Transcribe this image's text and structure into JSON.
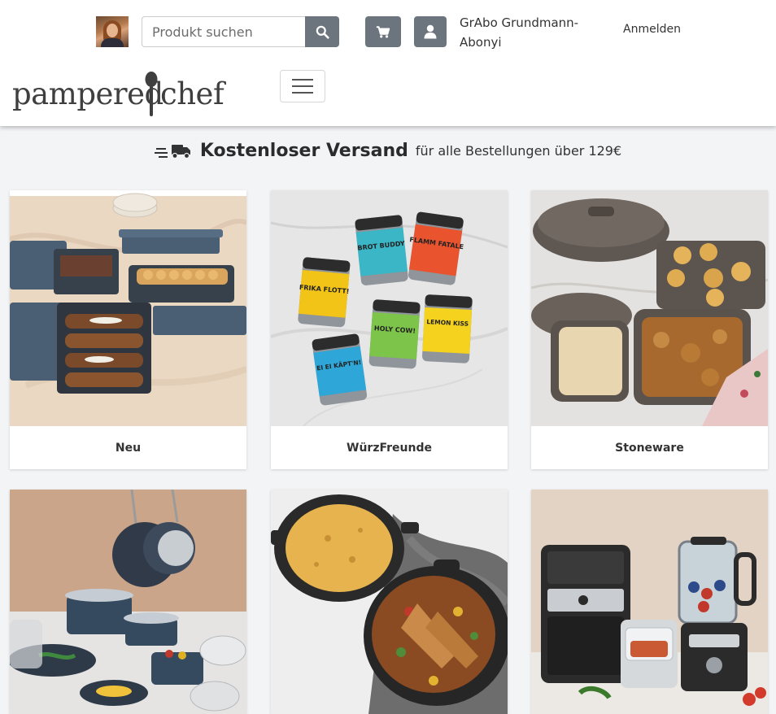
{
  "header": {
    "search": {
      "placeholder": "Produkt suchen",
      "icon": "search-icon"
    },
    "cart": {
      "icon": "cart-icon"
    },
    "user": {
      "icon": "user-icon",
      "name": "GrAbo Grundmann-Abonyi"
    },
    "login_label": "Anmelden",
    "logo": {
      "left": "pampered",
      "right": "chef"
    },
    "menu_icon": "hamburger-icon"
  },
  "shipping_banner": {
    "icon": "truck-icon",
    "bold": "Kostenloser Versand",
    "rest": "für alle Bestellungen über 129€"
  },
  "categories": [
    {
      "label": "Neu"
    },
    {
      "label": "WürzFreunde"
    },
    {
      "label": "Stoneware"
    },
    {
      "label": ""
    },
    {
      "label": ""
    },
    {
      "label": ""
    }
  ],
  "spice_labels": [
    "FRIKA FLOTT!",
    "BROT BUDDY",
    "FLAMM FATALE",
    "HOLY COW!",
    "LEMON KISS",
    "EI EI KÄPT'N!"
  ],
  "colors": {
    "accent_button": "#6c757d",
    "page_bg": "#f3f4f6",
    "header_bg": "#ffffff"
  }
}
